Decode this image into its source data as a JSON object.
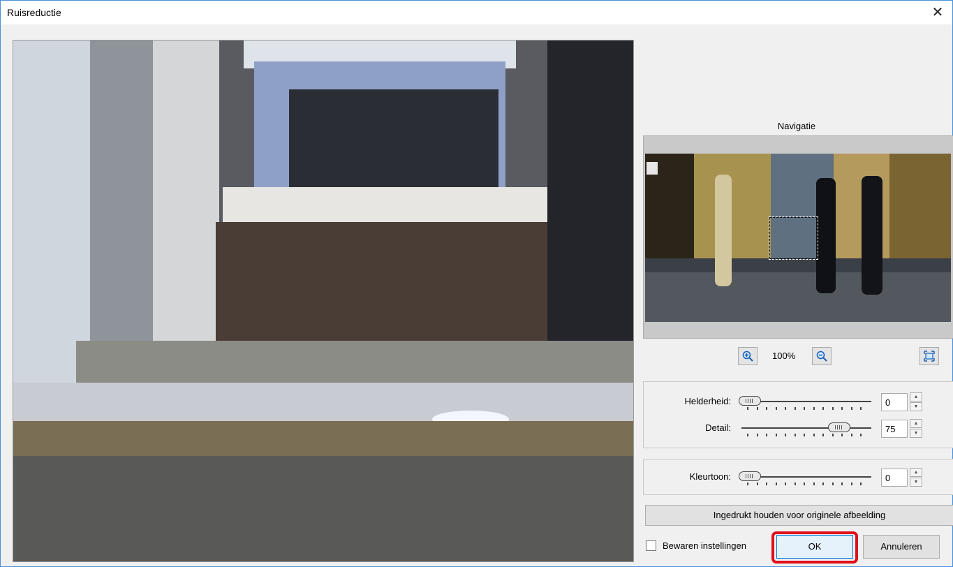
{
  "window": {
    "title": "Ruisreductie",
    "close_glyph": "✕"
  },
  "navigation": {
    "label": "Navigatie",
    "zoom_level": "100%"
  },
  "sliders": [
    {
      "label": "Helderheid:",
      "value": "0",
      "fraction": 0.0
    },
    {
      "label": "Detail:",
      "value": "75",
      "fraction": 0.75
    },
    {
      "label": "Kleurtoon:",
      "value": "0",
      "fraction": 0.0
    }
  ],
  "buttons": {
    "hold_original": "Ingedrukt houden voor originele afbeelding",
    "ok": "OK",
    "cancel": "Annuleren"
  },
  "checkbox": {
    "label": "Bewaren instellingen",
    "checked": false
  },
  "icons": {
    "zoom_in": "zoom-in-icon",
    "zoom_out": "zoom-out-icon",
    "fit": "fit-to-window-icon"
  },
  "colors": {
    "highlight": "#e0101a",
    "primary_border": "#0078d7"
  }
}
